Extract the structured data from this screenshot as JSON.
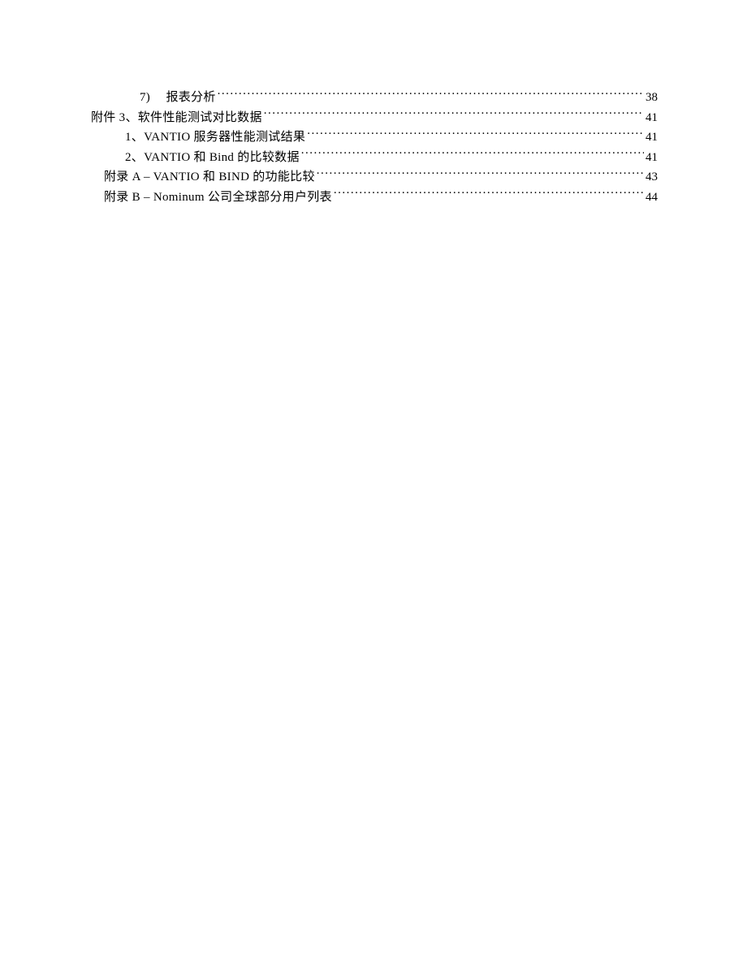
{
  "toc": {
    "entries": [
      {
        "indentClass": "indent-3",
        "text": "7)　 报表分析",
        "page": "38"
      },
      {
        "indentClass": "indent-0",
        "text": "附件 3、软件性能测试对比数据 ",
        "page": "41"
      },
      {
        "indentClass": "indent-2",
        "text": "1、VANTIO 服务器性能测试结果 ",
        "page": "41"
      },
      {
        "indentClass": "indent-2",
        "text": "2、VANTIO 和 Bind 的比较数据 ",
        "page": "41"
      },
      {
        "indentClass": "indent-1",
        "text": "附录 A  –  VANTIO 和 BIND 的功能比较 ",
        "page": "43"
      },
      {
        "indentClass": "indent-1",
        "text": "附录 B –  Nominum 公司全球部分用户列表 ",
        "page": "44"
      }
    ]
  }
}
